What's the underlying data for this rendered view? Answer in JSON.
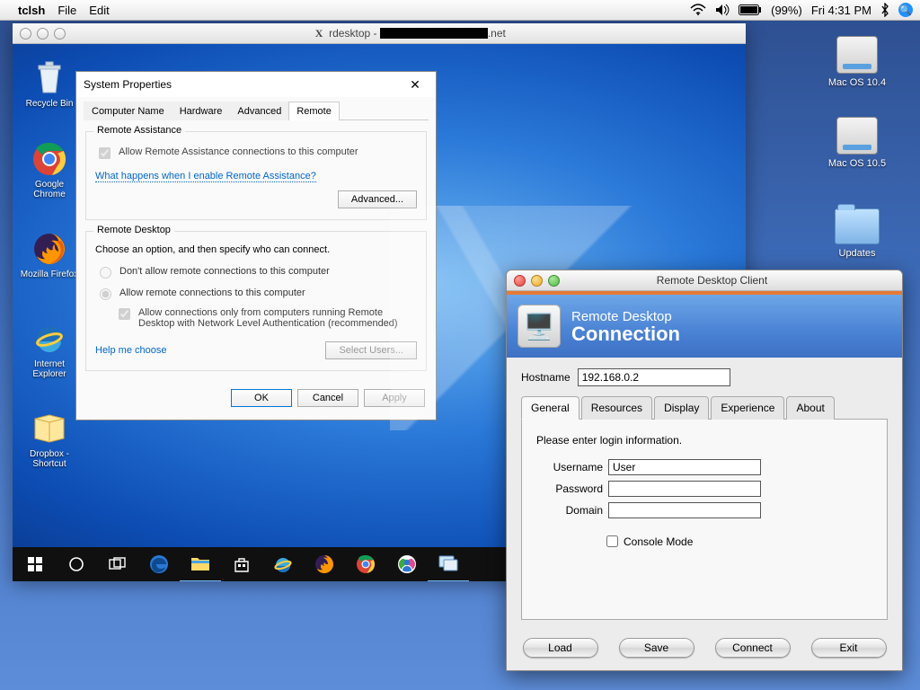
{
  "menubar": {
    "app": "tclsh",
    "menus": [
      "File",
      "Edit"
    ],
    "battery": "(99%)",
    "clock": "Fri 4:31 PM"
  },
  "mac_desktop": {
    "hd1": "Mac OS 10.4",
    "hd2": "Mac OS 10.5",
    "updates": "Updates"
  },
  "rdesktop": {
    "title_prefix": "rdesktop - ",
    "title_suffix": ".net"
  },
  "win_icons": {
    "recycle": "Recycle Bin",
    "chrome": "Google Chrome",
    "firefox": "Mozilla Firefox",
    "ie": "Internet Explorer",
    "dropbox": "Dropbox - Shortcut"
  },
  "sysprop": {
    "title": "System Properties",
    "tabs": [
      "Computer Name",
      "Hardware",
      "Advanced",
      "Remote"
    ],
    "ra_legend": "Remote Assistance",
    "ra_allow": "Allow Remote Assistance connections to this computer",
    "ra_link": "What happens when I enable Remote Assistance?",
    "adv_btn": "Advanced...",
    "rd_legend": "Remote Desktop",
    "rd_intro": "Choose an option, and then specify who can connect.",
    "rd_opt1": "Don't allow remote connections to this computer",
    "rd_opt2": "Allow remote connections to this computer",
    "rd_nla": "Allow connections only from computers running Remote Desktop with Network Level Authentication (recommended)",
    "help_link": "Help me choose",
    "select_users": "Select Users...",
    "ok": "OK",
    "cancel": "Cancel",
    "apply": "Apply"
  },
  "rdc": {
    "window_title": "Remote Desktop Client",
    "brand_l1": "Remote Desktop",
    "brand_l2": "Connection",
    "host_label": "Hostname",
    "host_value": "192.168.0.2",
    "tabs": [
      "General",
      "Resources",
      "Display",
      "Experience",
      "About"
    ],
    "prompt": "Please enter login information.",
    "user_label": "Username",
    "user_value": "User",
    "pass_label": "Password",
    "pass_value": "",
    "domain_label": "Domain",
    "domain_value": "",
    "console": "Console Mode",
    "btn_load": "Load",
    "btn_save": "Save",
    "btn_connect": "Connect",
    "btn_exit": "Exit"
  }
}
